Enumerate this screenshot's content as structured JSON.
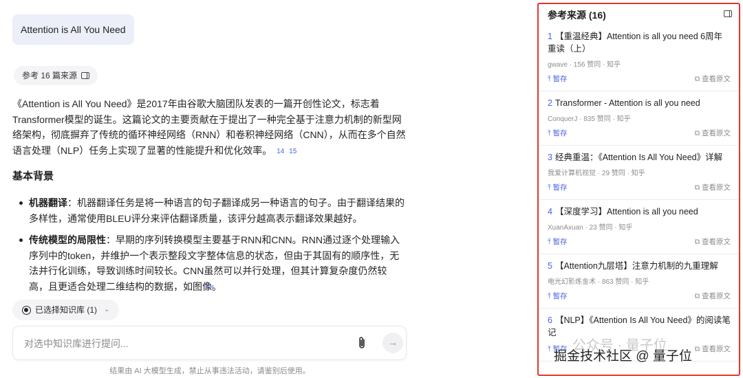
{
  "chat": {
    "user_message": "Attention is All You Need",
    "refs_chip": "参考 16 篇来源",
    "answer_intro": "《Attention is All You Need》是2017年由谷歌大脑团队发表的一篇开创性论文，标志着Transformer模型的诞生。这篇论文的主要贡献在于提出了一种完全基于注意力机制的新型网络架构，彻底摒弃了传统的循环神经网络（RNN）和卷积神经网络（CNN），从而在多个自然语言处理（NLP）任务上实现了显著的性能提升和优化效率。",
    "answer_cites": [
      "14",
      "15"
    ],
    "section_title": "基本背景",
    "bullets": [
      {
        "term": "机器翻译",
        "text": "：机器翻译任务是将一种语言的句子翻译成另一种语言的句子。由于翻译结果的多样性，通常使用BLEU评分来评估翻译质量，该评分越高表示翻译效果越好。"
      },
      {
        "term": "传统模型的局限性",
        "text": "：早期的序列转换模型主要基于RNN和CNN。RNN通过逐个处理输入序列中的token，并维护一个表示整段文字整体信息的状态，但由于其固有的顺序性，无法并行化训练，导致训练时间较长。CNN虽然可以并行处理，但其计算复杂度仍然较高，且更适合处理二维结构的数据，如图像。"
      }
    ],
    "scroll_down_glyph": "︾",
    "kb_chip": "已选择知识库 (1)",
    "input_placeholder": "对选中知识库进行提问...",
    "disclaimer": "结果由 AI 大模型生成，禁止从事违法活动，请鉴别后使用。"
  },
  "sources": {
    "title": "参考来源 (16)",
    "pause_label": "暂存",
    "view_label": "查看原文",
    "items": [
      {
        "num": "1",
        "title": "【重温经典】Attention is all you need 6周年重读（上）",
        "meta": "gwave · 156 赞同 · 知乎"
      },
      {
        "num": "2",
        "title": "Transformer - Attention is all you need",
        "meta": "ConquerJ · 835 赞同 · 知乎"
      },
      {
        "num": "3",
        "title": "经典重温：《Attention Is All You Need》详解",
        "meta": "我爱计算机视觉 · 29 赞同 · 知乎"
      },
      {
        "num": "4",
        "title": "【深度学习】Attention is all you need",
        "meta": "XuanAxuan · 23 赞同 · 知乎"
      },
      {
        "num": "5",
        "title": "【Attention九层塔】注意力机制的九重理解",
        "meta": "电光幻影炼金术 · 863 赞同 · 知乎"
      },
      {
        "num": "6",
        "title": "【NLP】《Attention Is All You Need》的阅读笔记",
        "meta": ""
      }
    ]
  },
  "watermark": {
    "line1": "公众号 · 量子位",
    "line2": "掘金技术社区 @ 量子位"
  }
}
